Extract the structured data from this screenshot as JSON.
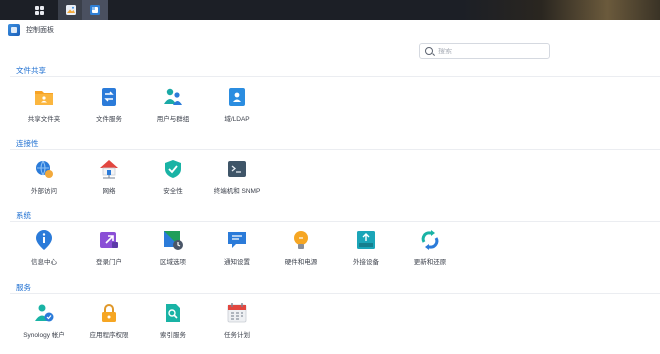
{
  "window": {
    "title": "控制面板"
  },
  "search": {
    "placeholder": "搜索"
  },
  "sections": [
    {
      "title": "文件共享",
      "items": [
        {
          "label": "共享文件夹",
          "icon": "shared-folder-icon"
        },
        {
          "label": "文件服务",
          "icon": "file-services-icon"
        },
        {
          "label": "用户与群组",
          "icon": "users-groups-icon"
        },
        {
          "label": "域/LDAP",
          "icon": "domain-ldap-icon"
        }
      ]
    },
    {
      "title": "连接性",
      "items": [
        {
          "label": "外部访问",
          "icon": "external-access-icon"
        },
        {
          "label": "网络",
          "icon": "network-icon"
        },
        {
          "label": "安全性",
          "icon": "security-shield-icon"
        },
        {
          "label": "终端机和 SNMP",
          "icon": "terminal-icon"
        }
      ]
    },
    {
      "title": "系统",
      "items": [
        {
          "label": "信息中心",
          "icon": "info-center-icon"
        },
        {
          "label": "登录门户",
          "icon": "login-portal-icon"
        },
        {
          "label": "区域选项",
          "icon": "regional-options-icon"
        },
        {
          "label": "通知设置",
          "icon": "notification-icon"
        },
        {
          "label": "硬件和电源",
          "icon": "hardware-power-icon"
        },
        {
          "label": "外接设备",
          "icon": "external-devices-icon"
        },
        {
          "label": "更新和还原",
          "icon": "update-restore-icon"
        }
      ]
    },
    {
      "title": "服务",
      "items": [
        {
          "label": "Synology 帐户",
          "icon": "synology-account-icon"
        },
        {
          "label": "应用程序权限",
          "icon": "app-privileges-icon"
        },
        {
          "label": "索引服务",
          "icon": "indexing-service-icon"
        },
        {
          "label": "任务计划",
          "icon": "task-scheduler-icon"
        }
      ]
    }
  ],
  "colors": {
    "accent": "#1e6fd1",
    "taskbar": "#1c1f26"
  }
}
